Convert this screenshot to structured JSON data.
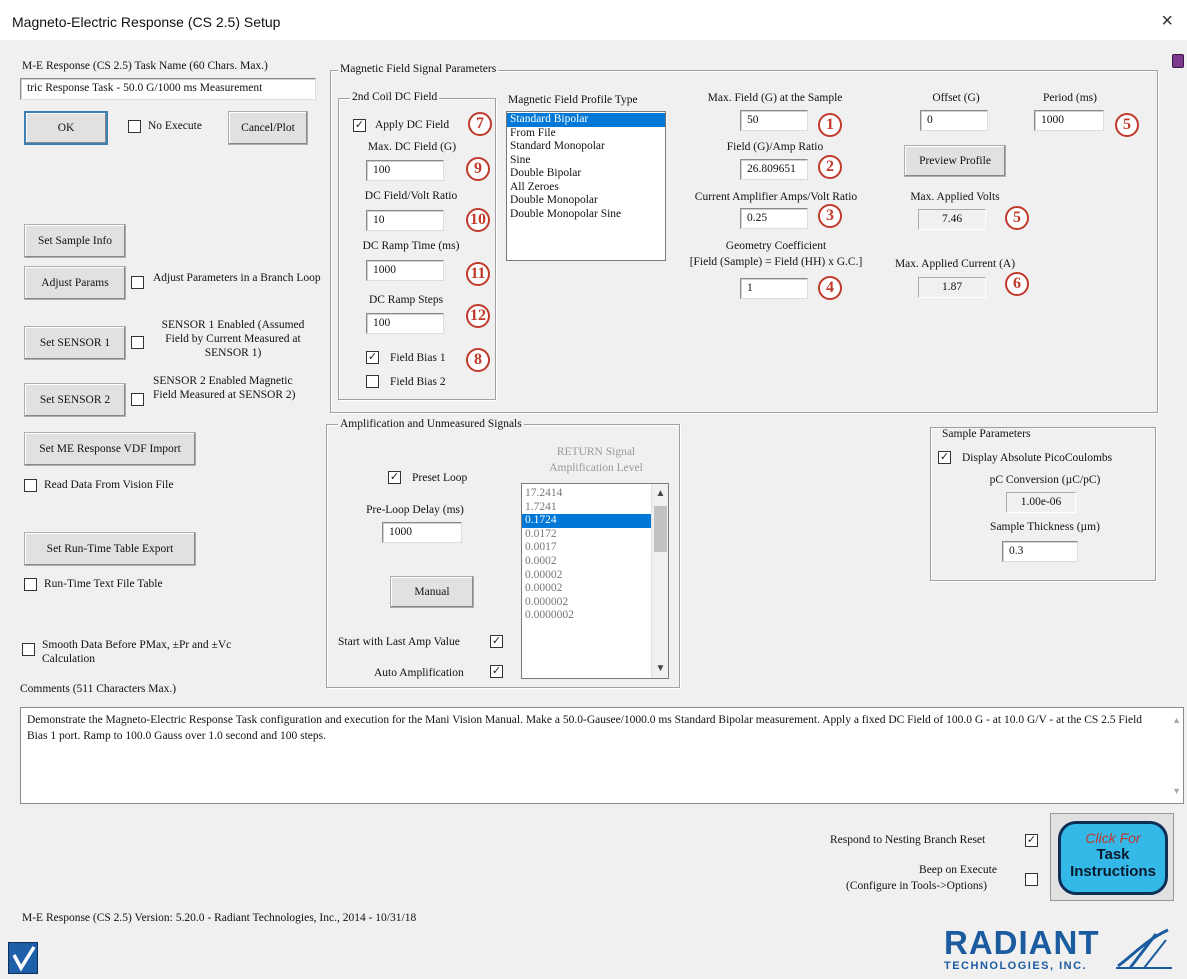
{
  "window": {
    "title": "Magneto-Electric Response (CS 2.5) Setup",
    "close_glyph": "×"
  },
  "task_name": {
    "label": "M-E Response (CS 2.5) Task Name (60 Chars. Max.)",
    "value": "tric Response Task - 50.0 G/1000 ms Measurement"
  },
  "buttons": {
    "ok": "OK",
    "cancel_plot": "Cancel/Plot",
    "set_sample_info": "Set Sample Info",
    "adjust_params": "Adjust Params",
    "set_sensor1": "Set SENSOR 1",
    "set_sensor2": "Set SENSOR 2",
    "vdf_import": "Set ME Response VDF Import",
    "runtime_export": "Set Run-Time Table Export",
    "preview_profile": "Preview Profile",
    "manual": "Manual"
  },
  "left_checks": {
    "no_execute": {
      "label": "No Execute",
      "checked": false
    },
    "adjust_loop": {
      "label": "Adjust Parameters in a Branch Loop",
      "checked": false
    },
    "sensor1": {
      "label": "SENSOR 1 Enabled (Assumed Field by Current Measured at SENSOR 1)",
      "checked": false
    },
    "sensor2": {
      "label": "SENSOR 2 Enabled Magnetic Field Measured at SENSOR 2)",
      "checked": false
    },
    "read_vision": {
      "label": "Read Data From Vision File",
      "checked": false
    },
    "runtime_text": {
      "label": "Run-Time Text File Table",
      "checked": false
    },
    "smooth": {
      "label": "Smooth Data Before PMax, ±Pr and ±Vc Calculation",
      "checked": false
    }
  },
  "mf_group": {
    "title": "Magnetic Field Signal Parameters",
    "coil": {
      "title": "2nd Coil DC Field",
      "apply_dc": {
        "label": "Apply DC Field",
        "checked": true
      },
      "max_dc_label": "Max. DC Field (G)",
      "max_dc_value": "100",
      "volt_ratio_label": "DC Field/Volt Ratio",
      "volt_ratio_value": "10",
      "ramp_time_label": "DC Ramp Time (ms)",
      "ramp_time_value": "1000",
      "ramp_steps_label": "DC Ramp Steps",
      "ramp_steps_value": "100",
      "bias1": {
        "label": "Field Bias 1",
        "checked": true
      },
      "bias2": {
        "label": "Field Bias 2",
        "checked": false
      }
    },
    "profile_label": "Magnetic Field Profile Type",
    "profiles": [
      "Standard Bipolar",
      "From File",
      "Standard Monopolar",
      "Sine",
      "Double Bipolar",
      "All Zeroes",
      "Double Monopolar",
      "Double Monopolar Sine"
    ],
    "profile_selected": "Standard Bipolar",
    "max_field_label": "Max. Field (G) at the Sample",
    "max_field_value": "50",
    "amp_ratio_label": "Field (G)/Amp Ratio",
    "amp_ratio_value": "26.809651",
    "cur_amp_label": "Current Amplifier Amps/Volt Ratio",
    "cur_amp_value": "0.25",
    "geom_label": "Geometry Coefficient",
    "geom_formula": "[Field (Sample) = Field (HH) x G.C.]",
    "geom_value": "1",
    "offset_label": "Offset (G)",
    "offset_value": "0",
    "period_label": "Period (ms)",
    "period_value": "1000",
    "max_volts_label": "Max. Applied Volts",
    "max_volts_value": "7.46",
    "max_current_label": "Max. Applied Current (A)",
    "max_current_value": "1.87"
  },
  "callouts": [
    "1",
    "2",
    "3",
    "4",
    "5",
    "5",
    "6",
    "7",
    "8",
    "9",
    "10",
    "11",
    "12"
  ],
  "amp_group": {
    "title": "Amplification and Unmeasured Signals",
    "preset_loop": {
      "label": "Preset Loop",
      "checked": true
    },
    "preloop_label": "Pre-Loop Delay (ms)",
    "preloop_value": "1000",
    "return_label": "RETURN Signal Amplification Level",
    "levels": [
      "17.2414",
      "1.7241",
      "0.1724",
      "0.0172",
      "0.0017",
      "0.0002",
      "0.00002",
      "0.00002",
      "0.000002",
      "0.0000002"
    ],
    "level_selected": "0.1724",
    "start_last": {
      "label": "Start with Last Amp Value",
      "checked": true
    },
    "auto_amp": {
      "label": "Auto Amplification",
      "checked": true
    }
  },
  "sample_group": {
    "title": "Sample Parameters",
    "display_abs": {
      "label": "Display Absolute PicoCoulombs",
      "checked": true
    },
    "pc_label": "pC Conversion (µC/pC)",
    "pc_value": "1.00e-06",
    "thick_label": "Sample Thickness (µm)",
    "thick_value": "0.3"
  },
  "comments": {
    "label": "Comments (511 Characters Max.)",
    "text": "Demonstrate the Magneto-Electric Response Task configuration and execution for the Mani Vision Manual. Make a 50.0-Gausee/1000.0 ms Standard Bipolar measurement. Apply a fixed DC Field of 100.0 G - at 10.0 G/V - at the  CS 2.5 Field Bias 1 port. Ramp to 100.0 Gauss over 1.0 second and 100 steps."
  },
  "bottom": {
    "nesting": {
      "label": "Respond to Nesting Branch Reset",
      "checked": true
    },
    "beep": {
      "label": "Beep on Execute",
      "sub": "(Configure in Tools->Options)",
      "checked": false
    },
    "version": "M-E Response (CS 2.5) Version: 5.20.0 - Radiant Technologies, Inc., 2014 - 10/31/18",
    "task_click": "Click For",
    "task_line1": "Task",
    "task_line2": "Instructions"
  },
  "logo": {
    "word": "RADIANT",
    "sub": "TECHNOLOGIES, INC."
  },
  "colors": {
    "callout": "#c0392b",
    "selection": "#0078d7",
    "task_button": "#33b8e8",
    "logo": "#1b5b9f"
  },
  "icons": {
    "close": "close-icon",
    "app": "vision-app-icon",
    "logo": "radiant-logo-icon"
  }
}
